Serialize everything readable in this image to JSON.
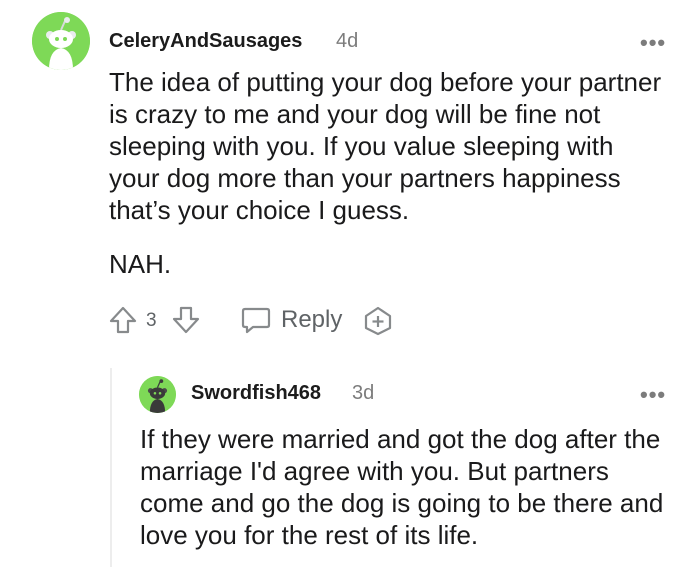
{
  "comment": {
    "username": "CeleryAndSausages",
    "age": "4d",
    "more_label": "•••",
    "paragraphs": [
      "The idea of putting your dog before your partner is crazy to me and your dog will be fine not sleeping with you. If you value sleeping with your dog more than your partners happiness that’s your choice I guess.",
      "NAH."
    ],
    "score": "3",
    "reply_label": "Reply",
    "icons": {
      "avatar": "snoo-avatar-icon",
      "upvote": "arrow-up-icon",
      "downvote": "arrow-down-icon",
      "reply": "speech-bubble-icon",
      "award": "plus-award-icon"
    }
  },
  "reply": {
    "username": "Swordfish468",
    "age": "3d",
    "more_label": "•••",
    "text": "If they were married and got the dog after the marriage I'd agree with you. But partners come and go the dog is going to be there and love you for the rest of its life.",
    "icons": {
      "avatar": "snoo-avatar-icon"
    }
  },
  "colors": {
    "avatar_bg": "#7ed957",
    "meta_gray": "#7c7c7c",
    "icon_gray": "#878a8c",
    "text": "#1a1a1b"
  }
}
